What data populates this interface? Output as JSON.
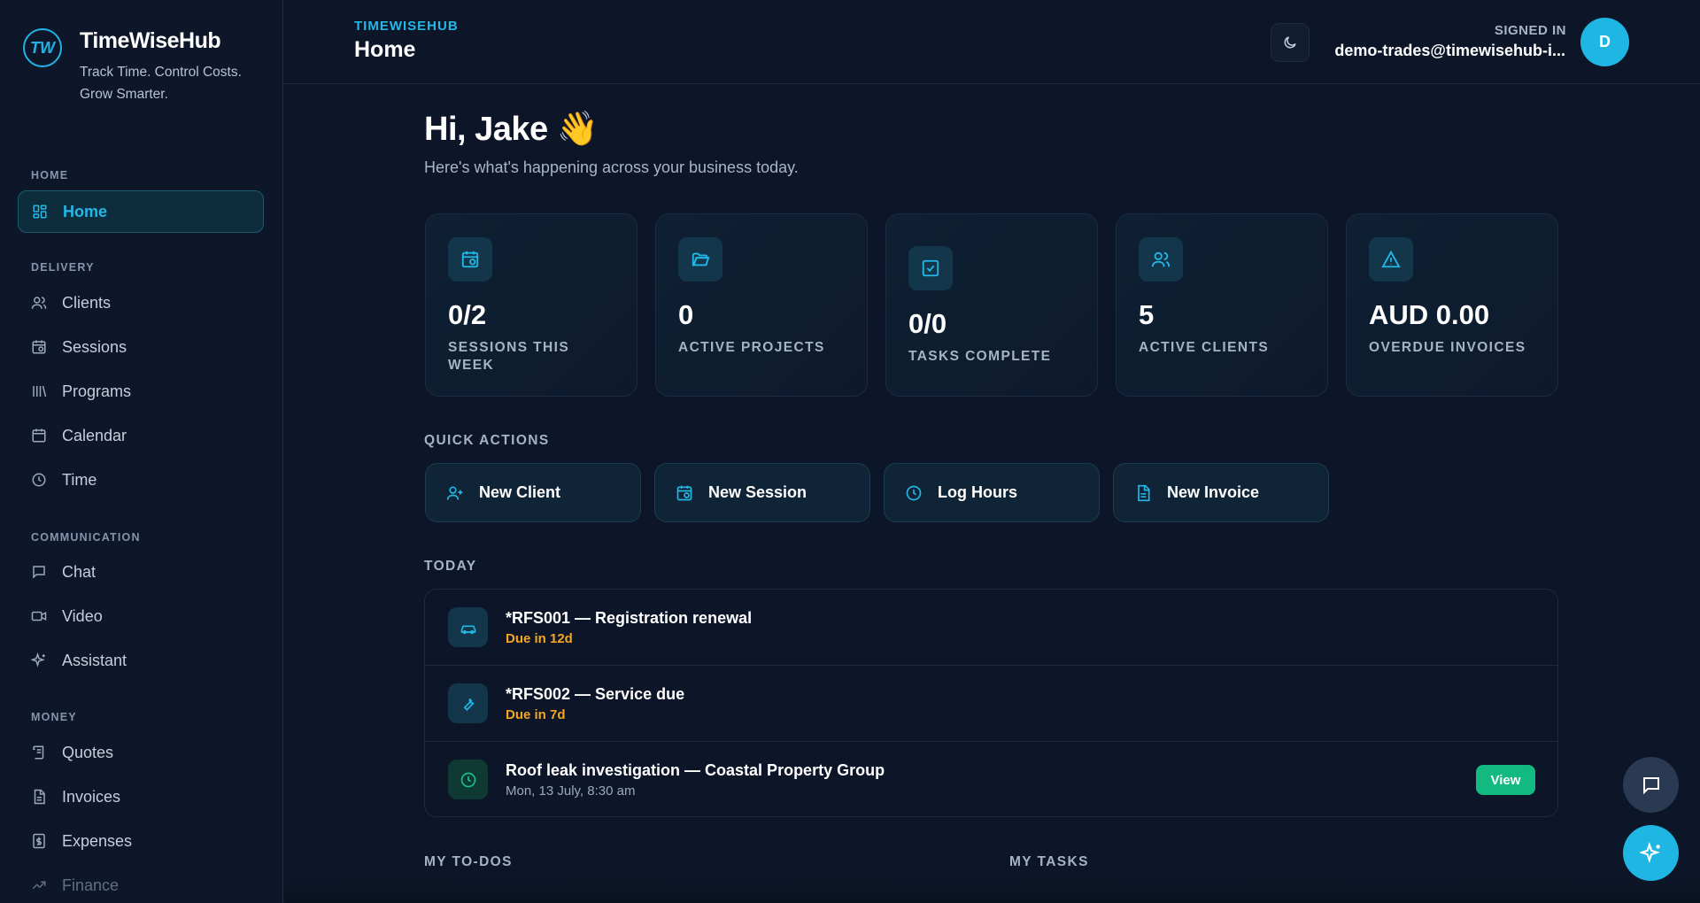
{
  "brand": {
    "logo_text": "TW",
    "name": "TimeWiseHub",
    "tagline_1": "Track Time. Control Costs.",
    "tagline_2": "Grow Smarter."
  },
  "sidebar": {
    "sections": {
      "home": "HOME",
      "delivery": "DELIVERY",
      "communication": "COMMUNICATION",
      "money": "MONEY"
    },
    "items": {
      "home": "Home",
      "clients": "Clients",
      "sessions": "Sessions",
      "programs": "Programs",
      "calendar": "Calendar",
      "time": "Time",
      "chat": "Chat",
      "video": "Video",
      "assistant": "Assistant",
      "quotes": "Quotes",
      "invoices": "Invoices",
      "expenses": "Expenses",
      "finance": "Finance"
    }
  },
  "header": {
    "eyebrow": "TIMEWISEHUB",
    "title": "Home",
    "signed_in_label": "SIGNED IN",
    "email": "demo-trades@timewisehub-i...",
    "avatar_initial": "D"
  },
  "main": {
    "greeting": "Hi, Jake 👋",
    "subgreeting": "Here's what's happening across your business today.",
    "stats": [
      {
        "value": "0/2",
        "label": "SESSIONS THIS WEEK"
      },
      {
        "value": "0",
        "label": "ACTIVE PROJECTS"
      },
      {
        "value": "0/0",
        "label": "TASKS COMPLETE"
      },
      {
        "value": "5",
        "label": "ACTIVE CLIENTS"
      },
      {
        "value": "AUD 0.00",
        "label": "OVERDUE INVOICES"
      }
    ],
    "quick_actions_title": "QUICK ACTIONS",
    "quick_actions": [
      {
        "label": "New Client"
      },
      {
        "label": "New Session"
      },
      {
        "label": "Log Hours"
      },
      {
        "label": "New Invoice"
      }
    ],
    "today_title": "TODAY",
    "today": [
      {
        "title": "*RFS001 — Registration renewal",
        "sub": "Due in 12d"
      },
      {
        "title": "*RFS002 — Service due",
        "sub": "Due in 7d"
      },
      {
        "title": "Roof leak investigation — Coastal Property Group",
        "sub": "Mon, 13 July, 8:30 am",
        "action": "View"
      }
    ],
    "todos_title": "MY TO-DOS",
    "tasks_title": "MY TASKS"
  }
}
